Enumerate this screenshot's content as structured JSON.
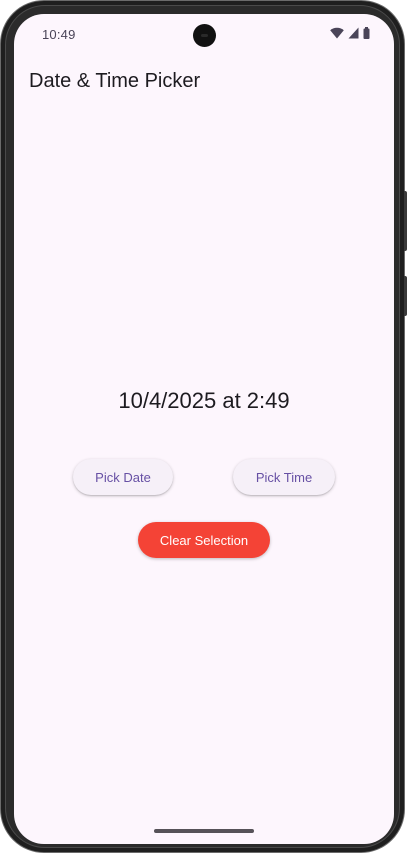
{
  "status_bar": {
    "time": "10:49",
    "icons": [
      "wifi-icon",
      "cellular-signal-icon",
      "battery-icon"
    ]
  },
  "app_bar": {
    "title": "Date & Time Picker"
  },
  "main": {
    "selection_text": "10/4/2025 at 2:49",
    "pick_date_label": "Pick Date",
    "pick_time_label": "Pick Time",
    "clear_label": "Clear Selection"
  },
  "colors": {
    "background": "#fdf6fd",
    "primary": "#6750a4",
    "button_surface": "#f6f0f8",
    "clear_button": "#f44336",
    "text": "#1d1b20"
  }
}
